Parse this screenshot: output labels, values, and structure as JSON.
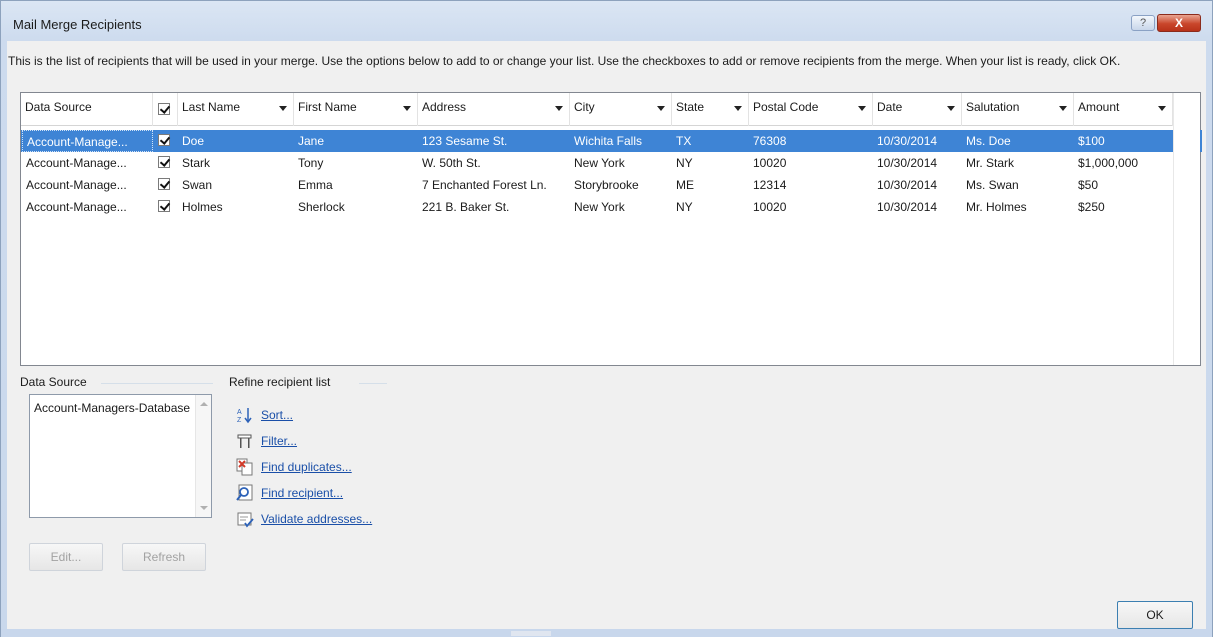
{
  "window": {
    "title": "Mail Merge Recipients",
    "help_label": "?",
    "close_label": "X"
  },
  "description": "This is the list of recipients that will be used in your merge.  Use the options below to add to or change your list.  Use the checkboxes to add or remove recipients from the merge.  When your list is ready, click OK.",
  "grid": {
    "columns": [
      "Data Source",
      "",
      "Last Name",
      "First Name",
      "Address",
      "City",
      "State",
      "Postal Code",
      "Date",
      "Salutation",
      "Amount"
    ],
    "rows": [
      {
        "source": "Account-Manage...",
        "checked": true,
        "last": "Doe",
        "first": "Jane",
        "address": "123 Sesame St.",
        "city": "Wichita Falls",
        "state": "TX",
        "postal": "76308",
        "date": "10/30/2014",
        "salutation": "Ms. Doe",
        "amount": "$100"
      },
      {
        "source": "Account-Manage...",
        "checked": true,
        "last": "Stark",
        "first": "Tony",
        "address": "W. 50th St.",
        "city": "New York",
        "state": "NY",
        "postal": "10020",
        "date": "10/30/2014",
        "salutation": "Mr. Stark",
        "amount": "$1,000,000"
      },
      {
        "source": "Account-Manage...",
        "checked": true,
        "last": "Swan",
        "first": "Emma",
        "address": "7 Enchanted Forest Ln.",
        "city": "Storybrooke",
        "state": "ME",
        "postal": "12314",
        "date": "10/30/2014",
        "salutation": "Ms. Swan",
        "amount": "$50"
      },
      {
        "source": "Account-Manage...",
        "checked": true,
        "last": "Holmes",
        "first": "Sherlock",
        "address": "221 B. Baker St.",
        "city": "New York",
        "state": "NY",
        "postal": "10020",
        "date": "10/30/2014",
        "salutation": "Mr. Holmes",
        "amount": "$250"
      }
    ]
  },
  "data_source": {
    "label": "Data Source",
    "item": "Account-Managers-Database",
    "edit_label": "Edit...",
    "refresh_label": "Refresh"
  },
  "refine": {
    "label": "Refine recipient list",
    "links": [
      {
        "label": "Sort...",
        "icon": "sort-icon"
      },
      {
        "label": "Filter...",
        "icon": "filter-icon"
      },
      {
        "label": "Find duplicates...",
        "icon": "find-duplicates-icon"
      },
      {
        "label": "Find recipient...",
        "icon": "find-recipient-icon"
      },
      {
        "label": "Validate addresses...",
        "icon": "validate-addresses-icon"
      }
    ]
  },
  "ok_label": "OK",
  "colors": {
    "selection": "#3e84d5",
    "link": "#1a4fa8"
  }
}
